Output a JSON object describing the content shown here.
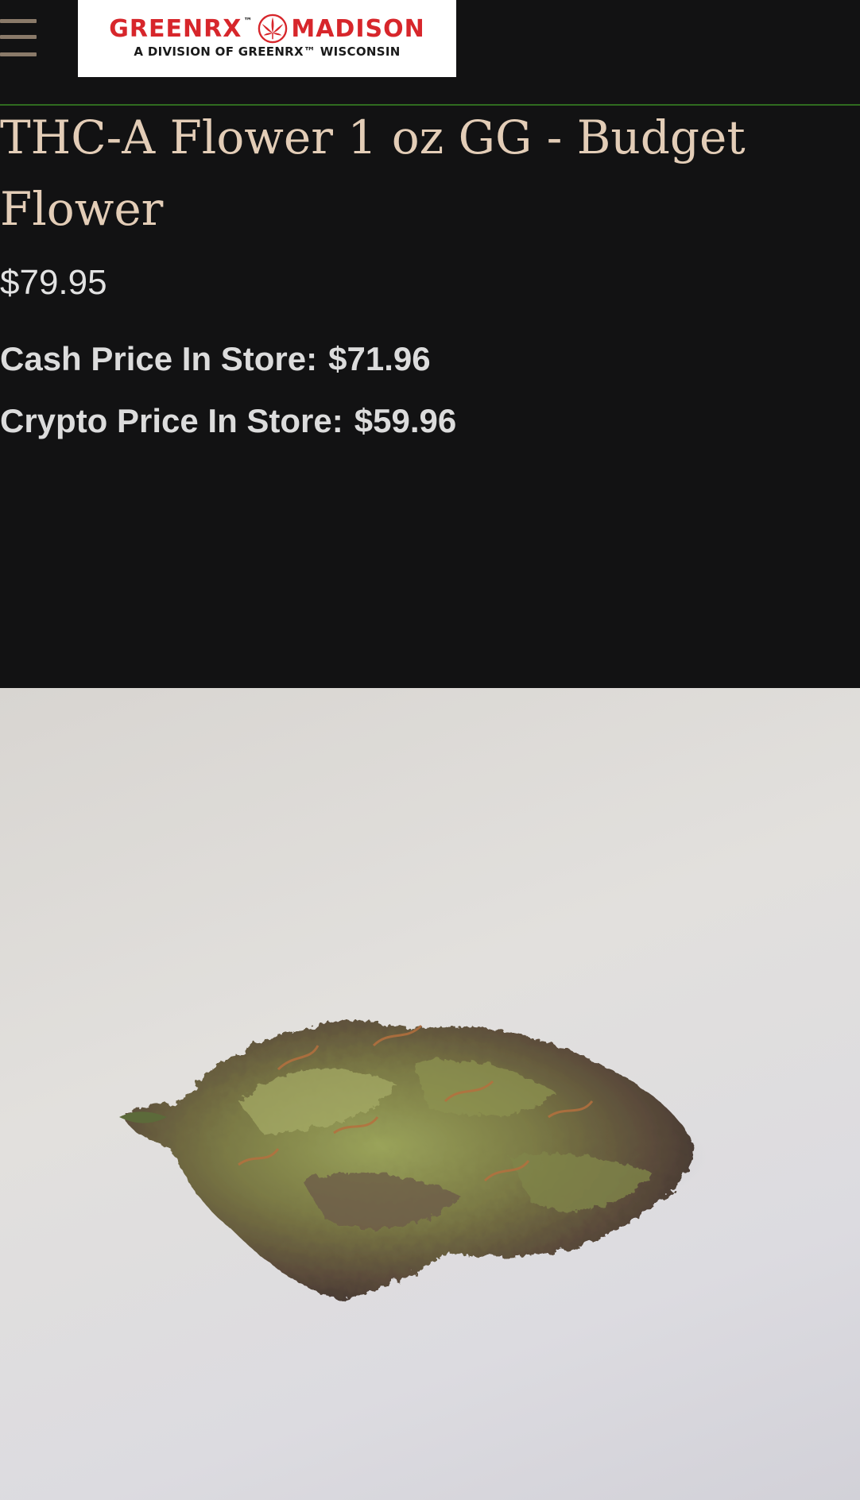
{
  "header": {
    "menu_icon": "hamburger-menu-icon",
    "logo": {
      "brand_left": "GREENRX",
      "trademark": "™",
      "brand_right": "MADISON",
      "tagline": "A DIVISION OF GREENRX™ WISCONSIN",
      "icon": "cannabis-leaf-icon"
    }
  },
  "product": {
    "title": "THC-A Flower 1 oz GG - Budget Flower",
    "price": "$79.95",
    "cash_price_label": "Cash Price In Store:",
    "cash_price_value": "$71.96",
    "crypto_price_label": "Crypto Price In Store:",
    "crypto_price_value": "$59.96",
    "image_subject": "cannabis-flower-bud-photo"
  },
  "colors": {
    "background": "#121213",
    "title": "#e3cdb7",
    "brand_red": "#d7262b",
    "divider_green": "#2f6b1f",
    "menu_icon": "#8a7a69"
  }
}
